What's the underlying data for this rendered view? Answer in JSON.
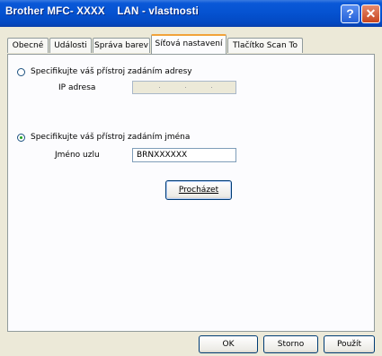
{
  "window": {
    "title": "Brother MFC- XXXX    LAN - vlastnosti",
    "help_label": "?",
    "close_label": "✕"
  },
  "tabs": [
    {
      "label": "Obecné"
    },
    {
      "label": "Události"
    },
    {
      "label": "Správa barev"
    },
    {
      "label": "Síťová nastavení",
      "active": true
    },
    {
      "label": "Tlačítko Scan To"
    }
  ],
  "panel": {
    "radio_address": {
      "label": "Specifikujte váš přístroj zadáním adresy",
      "checked": false
    },
    "ip_label": "IP adresa",
    "radio_name": {
      "label": "Specifikujte váš přístroj zadáním jména",
      "checked": true
    },
    "node_name_label": "Jméno uzlu",
    "node_name_value": "BRNXXXXXX",
    "browse_button": "Procházet"
  },
  "footer": {
    "ok": "OK",
    "cancel": "Storno",
    "apply": "Použít"
  }
}
